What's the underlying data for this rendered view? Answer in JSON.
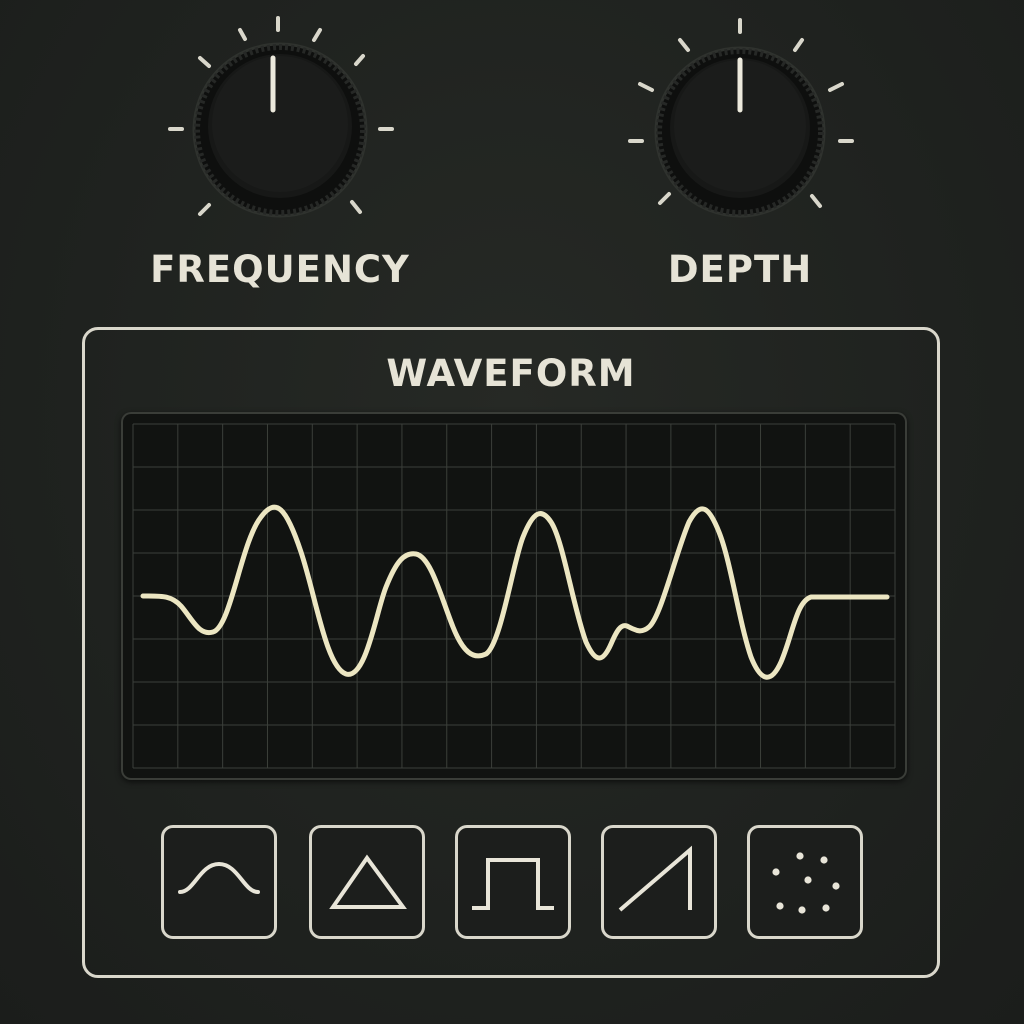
{
  "knobs": [
    {
      "label": "FREQUENCY",
      "level": 0.5
    },
    {
      "label": "DEPTH",
      "level": 0.5
    }
  ],
  "panel": {
    "title": "WAVEFORM"
  },
  "waveform_buttons": [
    {
      "icon": "sine-wave-icon"
    },
    {
      "icon": "triangle-wave-icon"
    },
    {
      "icon": "square-wave-icon"
    },
    {
      "icon": "sawtooth-wave-icon"
    },
    {
      "icon": "random-noise-icon"
    }
  ],
  "colors": {
    "background": "#1f221f",
    "text": "#e6e3d6",
    "trace": "#ece6c2",
    "grid": "#3b3f3a",
    "outline": "#d9d7cb"
  }
}
